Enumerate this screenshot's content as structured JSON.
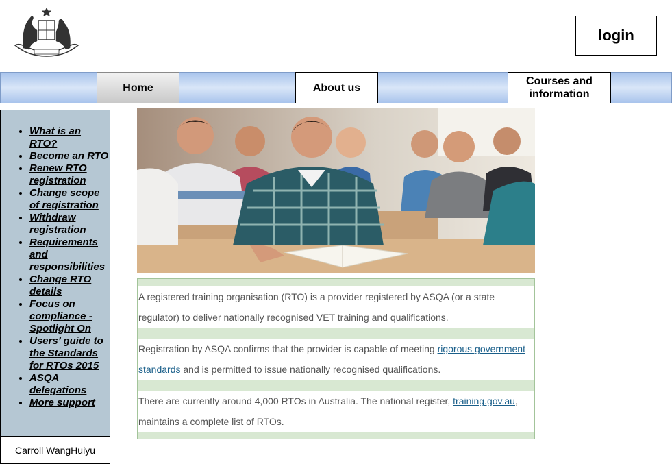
{
  "header": {
    "logo_icon": "coat-of-arms-icon",
    "login_label": "login"
  },
  "nav": {
    "home": "Home",
    "about": "About us",
    "courses": "Courses and information"
  },
  "sidebar": {
    "items": [
      {
        "label": "What is an RTO?"
      },
      {
        "label": "Become an RTO"
      },
      {
        "label": "Renew RTO registration"
      },
      {
        "label": "Change scope of registration"
      },
      {
        "label": "Withdraw registration"
      },
      {
        "label": "Requirements and responsibilities"
      },
      {
        "label": "Change RTO details"
      },
      {
        "label": "Focus on compliance - Spotlight On"
      },
      {
        "label": "Users’ guide to the Standards for RTOs 2015"
      },
      {
        "label": "ASQA delegations"
      },
      {
        "label": "More support "
      }
    ],
    "author": "Carroll WangHuiyu"
  },
  "content": {
    "hero_icon": "students-classroom-photo",
    "p1": "A registered training organisation (RTO) is a provider registered by ASQA (or a state regulator) to deliver nationally recognised VET training and qualifications.",
    "p2_before": "Registration by ASQA confirms that the provider is capable of meeting ",
    "p2_link": "rigorous government standards",
    "p2_after": " and is permitted to issue nationally recognised qualifications.",
    "p3_before": "There are currently around 4,000 RTOs in Australia. The national register, ",
    "p3_link": "training.gov.au",
    "p3_after": ", maintains a complete list of RTOs."
  },
  "colors": {
    "nav_gradient": "#a9c4ec",
    "sidebar_bg": "#b5c7d3",
    "content_band": "#d8e8d2",
    "link": "#1a5f8a"
  }
}
